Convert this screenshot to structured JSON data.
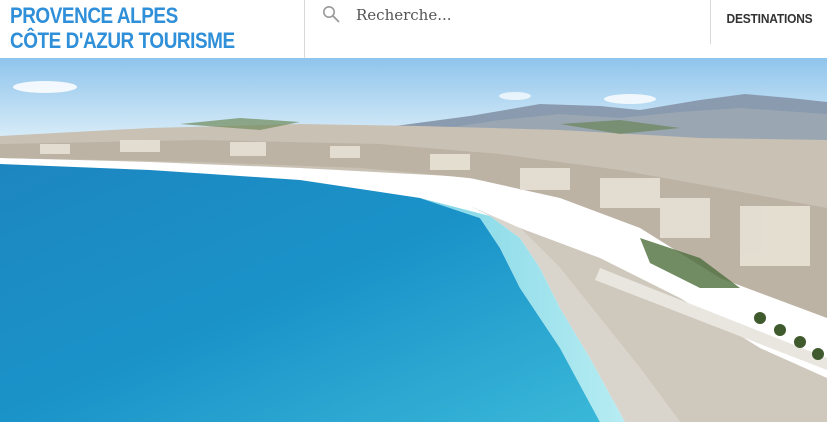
{
  "header": {
    "logo_line1": "PROVENCE ALPES",
    "logo_line2": "CÔTE D'AZUR TOURISME",
    "search_placeholder": "Recherche...",
    "nav_destinations": "DESTINATIONS"
  },
  "colors": {
    "brand_blue": "#2f8fd8",
    "nav_text": "#333333",
    "divider": "#d8d8d8"
  },
  "icons": {
    "search": "search-icon"
  }
}
